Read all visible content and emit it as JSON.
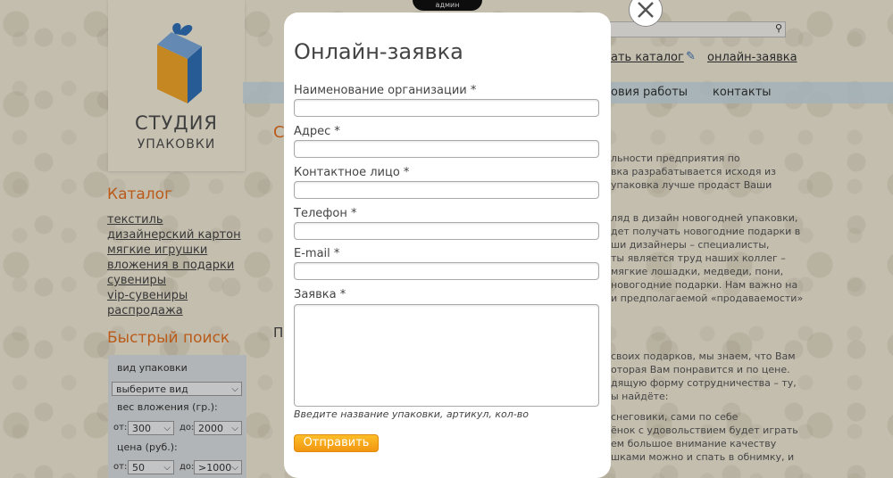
{
  "admin_tab": "админ",
  "logo": {
    "line1": "СТУДИЯ",
    "line2": "УПАКОВКИ"
  },
  "catalog": {
    "title": "Каталог",
    "items": [
      "текстиль",
      "дизайнерский картон",
      "мягкие игрушки",
      "вложения в подарки",
      "сувениры",
      "vip-сувениры",
      "распродажа"
    ]
  },
  "quick_search": {
    "title": "Быстрый поиск",
    "type_label": "вид упаковки",
    "type_value": "выберите вид",
    "weight_label": "вес вложения (гр.):",
    "weight_from_label": "от:",
    "weight_from": "300",
    "weight_to_label": "до:",
    "weight_to": "2000",
    "price_label": "цена (руб.):",
    "price_from_label": "от:",
    "price_from": "50",
    "price_to_label": "до:",
    "price_to": ">1000"
  },
  "header": {
    "catalog_link": "ать каталог",
    "order_link": "онлайн-заявка"
  },
  "nav": {
    "item1": "овия работы",
    "item2": "контакты"
  },
  "background_text": {
    "heading_fragment": "С",
    "heading2_fragment": "П",
    "lines": [
      "льности предприятия по",
      "вка разрабатывается исходя из",
      "упаковка лучше продаст Ваши",
      "",
      "ляд в дизайн новогодней упаковки,",
      "дет получать новогодние подарки в",
      "ши дизайнеры – специалисты,",
      "ты является труд наших коллег –",
      "мягкие лошадки, медведи, пони,",
      "новогодние подарки. Нам важно на",
      "и предполагаемой «продаваемости»",
      "",
      "",
      "своих подарков, мы знаем, что Вам",
      "оторая Вам понравится и по цене.",
      "дящую форму сотрудничества – ту,",
      "ы найдёте:",
      "",
      "снеговики, сами по себе",
      "ёнок с удовольствием будет играть",
      "ем большое внимание качеству",
      "шками можно и спать в обнимку, и"
    ]
  },
  "modal": {
    "title": "Онлайн-заявка",
    "fields": {
      "org": "Наименование организации *",
      "address": "Адрес *",
      "contact": "Контактное лицо *",
      "phone": "Телефон *",
      "email": "E-mail *",
      "request": "Заявка *"
    },
    "hint": "Введите название упаковки, артикул, кол-во",
    "submit": "Отправить"
  },
  "icons": {
    "close": "close-icon",
    "search": "search-icon",
    "pencil": "pencil-icon"
  },
  "colors": {
    "accent": "#e36f20",
    "button": "#f7a51b"
  }
}
